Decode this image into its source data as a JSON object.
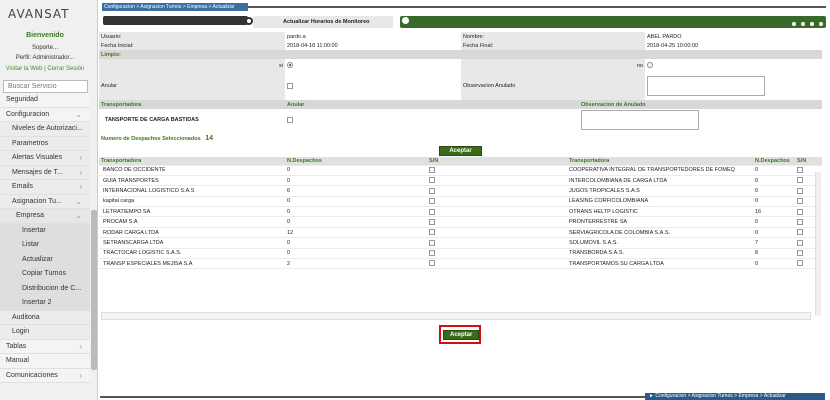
{
  "sidebar": {
    "logo": "AVANSAT",
    "welcome": "Bienvenido",
    "subtitle": "Soporte...",
    "profile": "Perfil: Administrador...",
    "links": "Visitar la Web | Cerrar Sesión",
    "search_placeholder": "Buscar Servicio",
    "menu": [
      {
        "label": "Seguridad",
        "level": 0,
        "arrow": ""
      },
      {
        "label": "Configuracion",
        "level": 0,
        "arrow": "⌄"
      },
      {
        "label": "Niveles de Autorizaci...",
        "level": 1,
        "arrow": ""
      },
      {
        "label": "Parametros",
        "level": 1,
        "arrow": ""
      },
      {
        "label": "Alertas Visuales",
        "level": 1,
        "arrow": "›"
      },
      {
        "label": "Mensajes de T...",
        "level": 1,
        "arrow": "›"
      },
      {
        "label": "Emails",
        "level": 1,
        "arrow": "›"
      },
      {
        "label": "Asignacion Tu...",
        "level": 1,
        "arrow": "⌄"
      },
      {
        "label": "Empresa",
        "level": 2,
        "arrow": "⌄"
      },
      {
        "label": "Insertar",
        "level": 3,
        "arrow": ""
      },
      {
        "label": "Listar",
        "level": 3,
        "arrow": ""
      },
      {
        "label": "Actualizar",
        "level": 3,
        "arrow": ""
      },
      {
        "label": "Copiar Turnos",
        "level": 3,
        "arrow": ""
      },
      {
        "label": "Distribucion de C...",
        "level": 3,
        "arrow": ""
      },
      {
        "label": "Insertar 2",
        "level": 3,
        "arrow": ""
      },
      {
        "label": "Auditoria",
        "level": 1,
        "arrow": ""
      },
      {
        "label": "Login",
        "level": 1,
        "arrow": ""
      },
      {
        "label": "Tablas",
        "level": 0,
        "arrow": "›"
      },
      {
        "label": "Manual",
        "level": 0,
        "arrow": ""
      },
      {
        "label": "Comunicaciones",
        "level": 0,
        "arrow": "›"
      }
    ]
  },
  "header": {
    "breadcrumb": "Configuracion > Asignacion Turnos > Empresa > Actualizar",
    "action_title": "Actualizar Horarios de Monitoreo"
  },
  "form": {
    "usuario_label": "Usuario:",
    "usuario_value": "pardo.a",
    "nombre_label": "Nombre:",
    "nombre_value": "ABEL PARDO",
    "fecha_inicial_label": "Fecha Inicial:",
    "fecha_inicial_value": "2018-04-18 11:00:00",
    "fecha_final_label": "Fecha Final:",
    "fecha_final_value": "2018-04-25 10:00:00",
    "limpio_label": "Limpio:",
    "si_label": "si",
    "no_label": "no",
    "anular_label": "Anular",
    "obs_anulado_label": "Observacion Anulado",
    "transp_col": "Transportadora",
    "anular_col": "Anular",
    "obs_col": "Observacion de Anulado",
    "transp_value": "TANSPORTE DE CARGA BASTIDAS",
    "num_despachos_label": "Numero de Despachos Seleccionados",
    "num_despachos_value": "14",
    "accept_label": "Aceptar"
  },
  "grid": {
    "headers": [
      "Transportadora",
      "N.Despachos",
      "S/N",
      "Transportadora",
      "N.Despachos",
      "S/N"
    ],
    "rows": [
      [
        "BANCO DE OCCIDENTE",
        "0",
        "COOPERATIVA INTEGRAL DE TRANSPORTEDORES DE FOMEQ",
        "0"
      ],
      [
        "GUIA TRANSPORTES",
        "0",
        "INTERCOLOMBIANA DE CARGA LTDA",
        "0"
      ],
      [
        "INTERNACIONAL LOGISTICO S.A.S",
        "6",
        "JUGOS TROPICALES S.A.S",
        "0"
      ],
      [
        "kapital carga",
        "0",
        "LEASING CORFICOLOMBIANA",
        "0"
      ],
      [
        "LETRATIEMPO SA",
        "0",
        "OTRANS HELTP LOGISTIC",
        "16"
      ],
      [
        "PROCAM S.A",
        "0",
        "PRONTERRESTRE SA",
        "0"
      ],
      [
        "RODAR CARGA LTDA",
        "12",
        "SERVIAGRICOLA DE COLOMBIA S.A.S.",
        "0"
      ],
      [
        "SETRANSCARGA LTDA",
        "0",
        "SOLUMOVIL S.A.S.",
        "7"
      ],
      [
        "TRACTOCAR LOGISTIC S.A.S.",
        "0",
        "TRANSBORDA S.A.S.",
        "8"
      ],
      [
        "TRANSP ESPECIALES MEJISA S.A",
        "2",
        "TRANSPORTAMOS SU CARGA LTDA",
        "0"
      ]
    ]
  },
  "footer": {
    "breadcrumb": "► Configuracion > Asignacion Turnos > Empresa > Actualizar"
  },
  "colors": {
    "accent_green": "#3a6a1a",
    "breadcrumb_blue": "#3a6fa0",
    "highlight_red": "#d01010"
  }
}
